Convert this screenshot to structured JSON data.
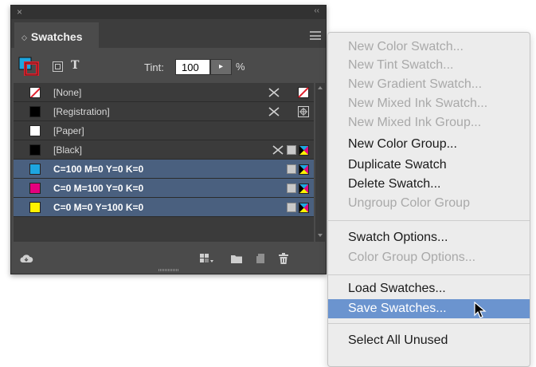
{
  "panel": {
    "close_glyph": "×",
    "collapse_glyph": "‹‹",
    "tab_arrow_glyph": "◇",
    "tab_label": "Swatches",
    "text_button_glyph": "T",
    "tint_label": "Tint:",
    "tint_value": "100",
    "tint_stepper_glyph": "▸",
    "tint_unit": "%",
    "swatches": [
      {
        "name": "[None]",
        "chip": "none",
        "selected": false
      },
      {
        "name": "[Registration]",
        "chip": "#000000",
        "selected": false
      },
      {
        "name": "[Paper]",
        "chip": "#ffffff",
        "selected": false
      },
      {
        "name": "[Black]",
        "chip": "#000000",
        "selected": false
      },
      {
        "name": "C=100 M=0 Y=0 K=0",
        "chip": "#1ea6e0",
        "selected": true
      },
      {
        "name": "C=0 M=100 Y=0 K=0",
        "chip": "#e6007e",
        "selected": true
      },
      {
        "name": "C=0 M=0 Y=100 K=0",
        "chip": "#fff200",
        "selected": true
      }
    ],
    "selection_color": "#4a607f",
    "bottom_icons": [
      "cloud-icon",
      "show-swatch-kinds-icon",
      "new-color-group-icon",
      "new-swatch-icon",
      "delete-swatch-icon"
    ]
  },
  "menu": {
    "items": [
      {
        "label": "New Color Swatch...",
        "enabled": false
      },
      {
        "label": "New Tint Swatch...",
        "enabled": false
      },
      {
        "label": "New Gradient Swatch...",
        "enabled": false
      },
      {
        "label": "New Mixed Ink Swatch...",
        "enabled": false
      },
      {
        "label": "New Mixed Ink Group...",
        "enabled": false
      },
      {
        "label": "New Color Group...",
        "enabled": true
      },
      {
        "label": "Duplicate Swatch",
        "enabled": true
      },
      {
        "label": "Delete Swatch...",
        "enabled": true
      },
      {
        "label": "Ungroup Color Group",
        "enabled": false
      },
      {
        "label": "Swatch Options...",
        "enabled": true
      },
      {
        "label": "Color Group Options...",
        "enabled": false
      },
      {
        "label": "Load Swatches...",
        "enabled": true
      },
      {
        "label": "Save Swatches...",
        "enabled": true,
        "highlighted": true
      },
      {
        "label": "Select All Unused",
        "enabled": true
      }
    ],
    "highlight_color": "#6b94cf"
  }
}
